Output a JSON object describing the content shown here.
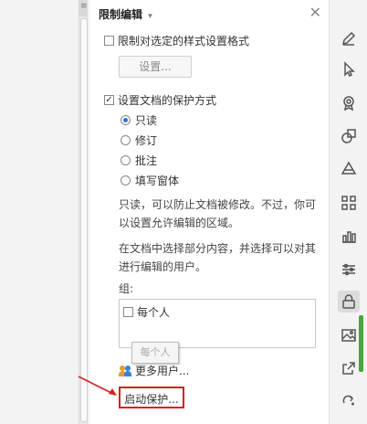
{
  "panel": {
    "title": "限制编辑",
    "caret": "▾",
    "close": "✕",
    "format_restrict": {
      "label": "限制对选定的样式设置格式",
      "checked": false,
      "settings_button": "设置..."
    },
    "protect": {
      "label": "设置文档的保护方式",
      "checked": true,
      "options": [
        {
          "label": "只读",
          "selected": true
        },
        {
          "label": "修订",
          "selected": false
        },
        {
          "label": "批注",
          "selected": false
        },
        {
          "label": "填写窗体",
          "selected": false
        }
      ]
    },
    "desc1_line1": "只读，可以防止文档被修改。不过，你可",
    "desc1_line2": "以设置允许编辑的区域。",
    "desc2_line1": "在文档中选择部分内容，并选择可以对其",
    "desc2_line2": "进行编辑的用户。",
    "group_label": "组:",
    "group_item": "每个人",
    "tooltip": "每个人",
    "more_users": "更多用户...",
    "start_button": "启动保护..."
  },
  "right_toolbar": [
    {
      "icon": "pen-icon",
      "active": false
    },
    {
      "icon": "cursor-icon",
      "active": false
    },
    {
      "icon": "badge-icon",
      "active": false
    },
    {
      "icon": "shapes-icon",
      "active": false
    },
    {
      "icon": "layers-icon",
      "active": false
    },
    {
      "icon": "grid-icon",
      "active": false
    },
    {
      "icon": "bar-chart-icon",
      "active": false
    },
    {
      "icon": "sliders-icon",
      "active": false
    },
    {
      "icon": "lock-icon",
      "active": true
    },
    {
      "icon": "image-icon",
      "active": false
    },
    {
      "icon": "share-icon",
      "active": false
    },
    {
      "icon": "redo-icon",
      "active": false
    }
  ],
  "colors": {
    "accent": "#2f6fd6",
    "highlight": "#d91f1f",
    "scroll": "#49a33e"
  }
}
